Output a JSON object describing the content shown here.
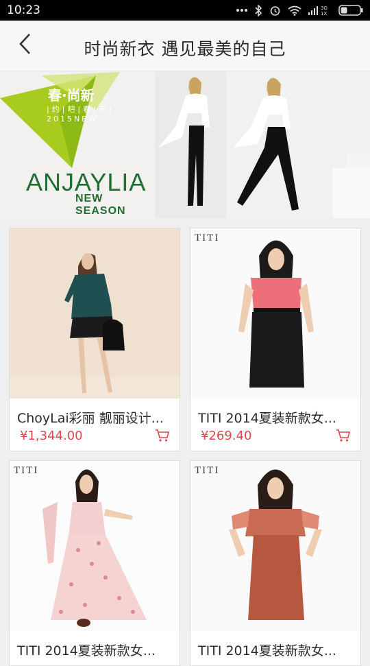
{
  "status_bar": {
    "time": "10:23",
    "network": "3G",
    "network_sub": "1X"
  },
  "header": {
    "back_icon": "chevron-left-icon",
    "title": "时尚新衣 遇见最美的自己"
  },
  "banner": {
    "logo_text": "春·尚新",
    "logo_sub": "|约|吧|春|天|",
    "logo_year": "2015NEW",
    "brand": "ANJAYLIA",
    "tagline": "NEW SEASON",
    "colors": {
      "brand_green": "#1f6e32",
      "lime": "#a8cb1f"
    }
  },
  "products": [
    {
      "name": "ChoyLai彩丽 靓丽设计...",
      "price": "¥1,344.00",
      "watermark": ""
    },
    {
      "name": "TITI 2014夏装新款女...",
      "price": "¥269.40",
      "watermark": "TITI"
    },
    {
      "name": "TITI 2014夏装新款女...",
      "price": "",
      "watermark": "TITI"
    },
    {
      "name": "TITI 2014夏装新款女...",
      "price": "",
      "watermark": "TITI"
    }
  ],
  "colors": {
    "price_red": "#e2474a",
    "accent": "#e2474a"
  }
}
